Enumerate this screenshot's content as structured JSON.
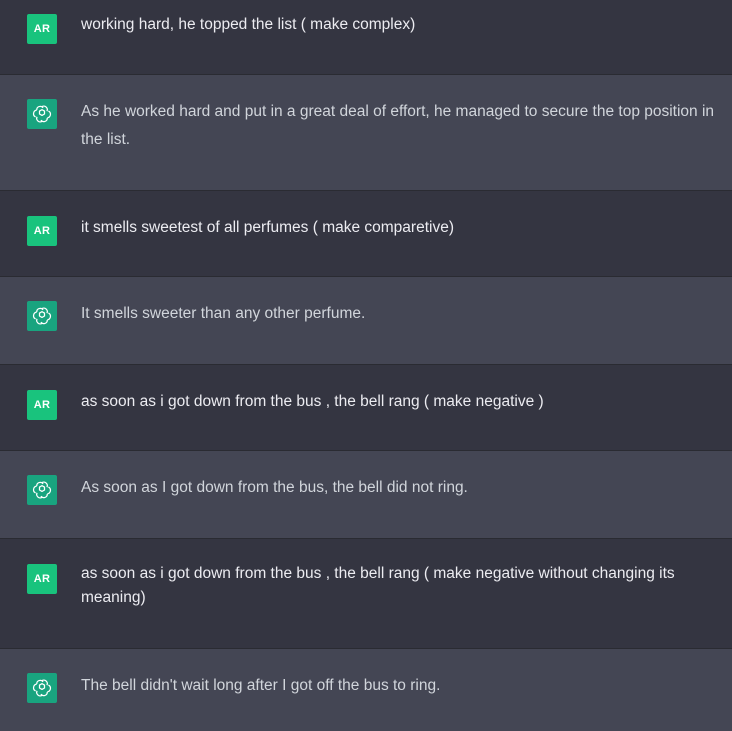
{
  "conversation": {
    "messages": [
      {
        "role": "user",
        "avatar_label": "AR",
        "text": "working hard, he topped the list ( make complex)"
      },
      {
        "role": "assistant",
        "avatar_icon": "openai-logo-icon",
        "text": "As he worked hard and put in a great deal of effort, he managed to secure the top position in the list."
      },
      {
        "role": "user",
        "avatar_label": "AR",
        "text": "it smells sweetest of all perfumes ( make comparetive)"
      },
      {
        "role": "assistant",
        "avatar_icon": "openai-logo-icon",
        "text": "It smells sweeter than any other perfume."
      },
      {
        "role": "user",
        "avatar_label": "AR",
        "text": "as soon as i got down from the bus , the bell rang ( make negative )"
      },
      {
        "role": "assistant",
        "avatar_icon": "openai-logo-icon",
        "text": "As soon as I got down from the bus, the bell did not ring."
      },
      {
        "role": "user",
        "avatar_label": "AR",
        "text": "as soon as i got down from the bus , the bell rang ( make negative without changing its meaning)"
      },
      {
        "role": "assistant",
        "avatar_icon": "openai-logo-icon",
        "text": "The bell didn't wait long after I got off the bus to ring."
      }
    ]
  },
  "colors": {
    "user_bg": "#343541",
    "assistant_bg": "#444654",
    "user_avatar": "#19c37d",
    "assistant_avatar": "#19a47f"
  }
}
